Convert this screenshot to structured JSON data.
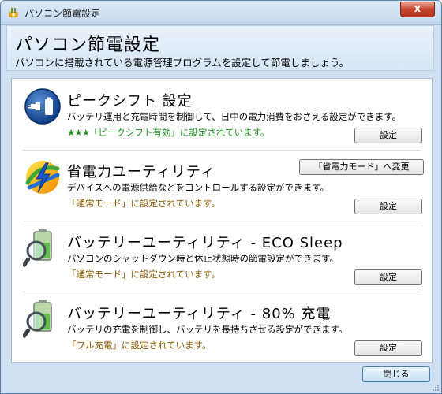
{
  "window": {
    "title": "パソコン節電設定",
    "close_glyph": "x"
  },
  "header": {
    "title": "パソコン節電設定",
    "subtitle": "パソコンに搭載されている電源管理プログラムを設定して節電しましょう。"
  },
  "items": [
    {
      "title": "ピークシフト 設定",
      "description": "バッテリ運用と充電時間を制御して、日中の電力消費をおさえる設定ができます。",
      "stars": "★★★",
      "status": "「ピークシフト有効」に設定されています。",
      "button": "設定",
      "icon": "peak-shift-plug-battery-icon"
    },
    {
      "title": "省電力ユーティリティ",
      "description": "デバイスへの電源供給などをコントロールする設定ができます。",
      "status": "「通常モード」に設定されています。",
      "button": "設定",
      "mode_button": "「省電力モード」へ変更",
      "icon": "power-saving-lightning-icon"
    },
    {
      "title": "バッテリーユーティリティ - ECO Sleep",
      "description": "パソコンのシャットダウン時と休止状態時の節電設定ができます。",
      "status": "「通常モード」に設定されています。",
      "button": "設定",
      "icon": "battery-magnifier-icon"
    },
    {
      "title": "バッテリーユーティリティ - 80% 充電",
      "description": "バッテリの充電を制御し、バッテリを長持ちさせる設定ができます。",
      "status": "「フル充電」に設定されています。",
      "button": "設定",
      "icon": "battery-magnifier-icon"
    }
  ],
  "footer": {
    "close_button": "閉じる"
  },
  "colors": {
    "status_orange": "#8a5a00",
    "status_green": "#1e8e1e",
    "close_red": "#c6452e"
  }
}
